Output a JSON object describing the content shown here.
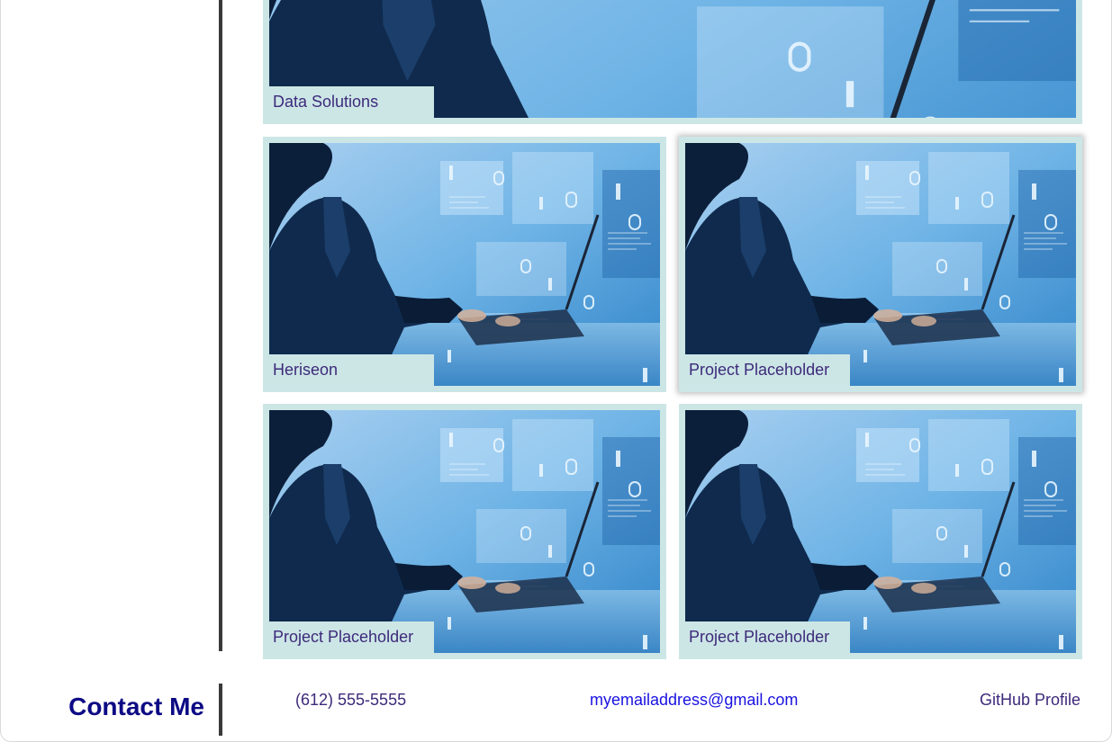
{
  "projects": {
    "featured_label": "Data Solutions",
    "items": [
      {
        "label": "Heriseon"
      },
      {
        "label": "Project Placeholder"
      },
      {
        "label": "Project Placeholder"
      },
      {
        "label": "Project Placeholder"
      }
    ]
  },
  "contact": {
    "title": "Contact Me",
    "phone": "(612) 555-5555",
    "email": "myemailaddress@gmail.com",
    "github": "GitHub Profile"
  },
  "colors": {
    "card_background": "#cce6e6",
    "label_text": "#3d2a7a",
    "title": "#0c0a84",
    "email_link": "#1a12e0",
    "divider": "#3a3a3a"
  }
}
